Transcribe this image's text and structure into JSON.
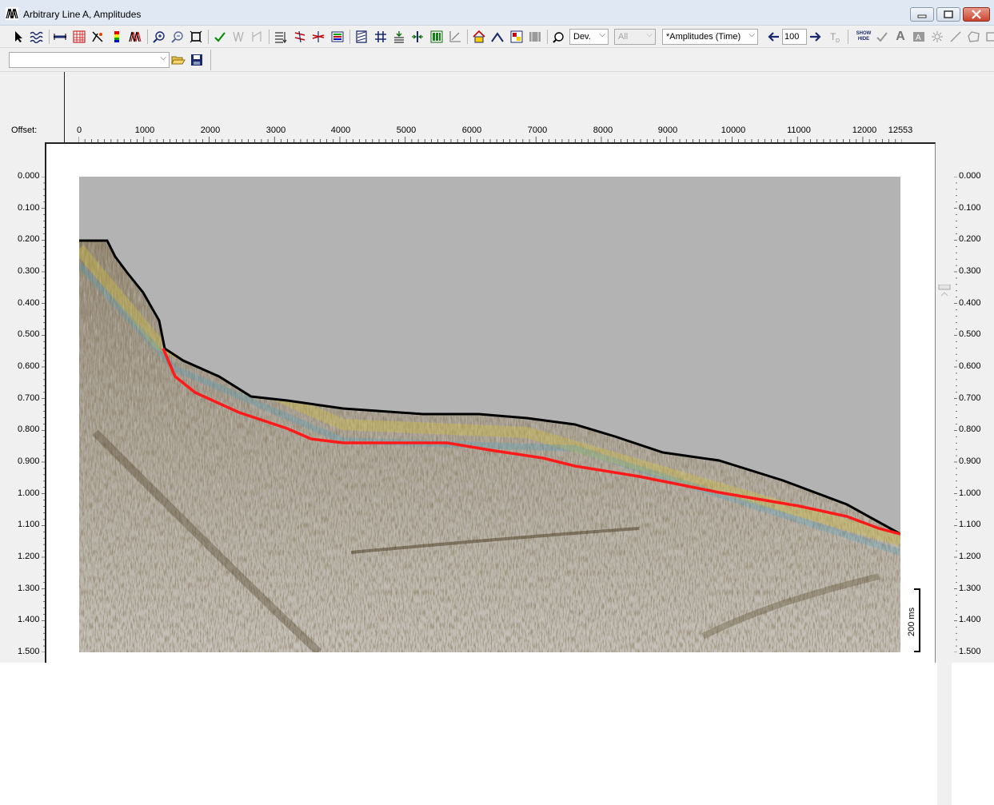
{
  "window": {
    "title": "Arbitrary Line A, Amplitudes",
    "minimize_icon": "minimize-icon",
    "maximize_icon": "maximize-icon",
    "close_icon": "close-icon"
  },
  "toolbar": {
    "pointer_icon": "pointer-icon",
    "tools": [
      "select-arrow-icon",
      "wiggle-icon",
      "horizon-icon",
      "grid-icon",
      "interpret-icon",
      "colorbar-icon",
      "seismic-icon",
      "zoom-in-icon",
      "zoom-out-icon",
      "zoom-fit-icon",
      "check-icon",
      "wiggle-off-icon",
      "wiggle-mode-icon",
      "trace-list-icon",
      "pick-icon",
      "cross-icon",
      "layers-icon",
      "hatch-icon",
      "measure-icon",
      "align-icon",
      "split-icon",
      "bars-icon",
      "graph-icon",
      "house-icon",
      "chevron-icon",
      "flag-icon",
      "filmstrip-icon",
      "palette-icon"
    ],
    "dev_combo": "Dev.",
    "all_combo": "All",
    "volume_combo": "*Amplitudes (Time)",
    "step_value": "100",
    "show_hide_label": "SHOW HIDE",
    "text_tool": "A"
  },
  "toolbar2": {
    "combo_value": "",
    "open_icon": "folder-open-icon",
    "save_icon": "save-icon"
  },
  "ruler": {
    "offset_label": "Offset:",
    "ticks": [
      "0",
      "1000",
      "2000",
      "3000",
      "4000",
      "5000",
      "6000",
      "7000",
      "8000",
      "9000",
      "10000",
      "11000",
      "12000",
      "12553"
    ]
  },
  "time_axis": {
    "labels": [
      "0.000",
      "0.100",
      "0.200",
      "0.300",
      "0.400",
      "0.500",
      "0.600",
      "0.700",
      "0.800",
      "0.900",
      "1.000",
      "1.100",
      "1.200",
      "1.300",
      "1.400",
      "1.500"
    ]
  },
  "scale_bar": {
    "label": "200 ms"
  },
  "colors": {
    "seafloor": "#000000",
    "horizon": "#ff1a1a",
    "background": "#b3b3b3"
  }
}
